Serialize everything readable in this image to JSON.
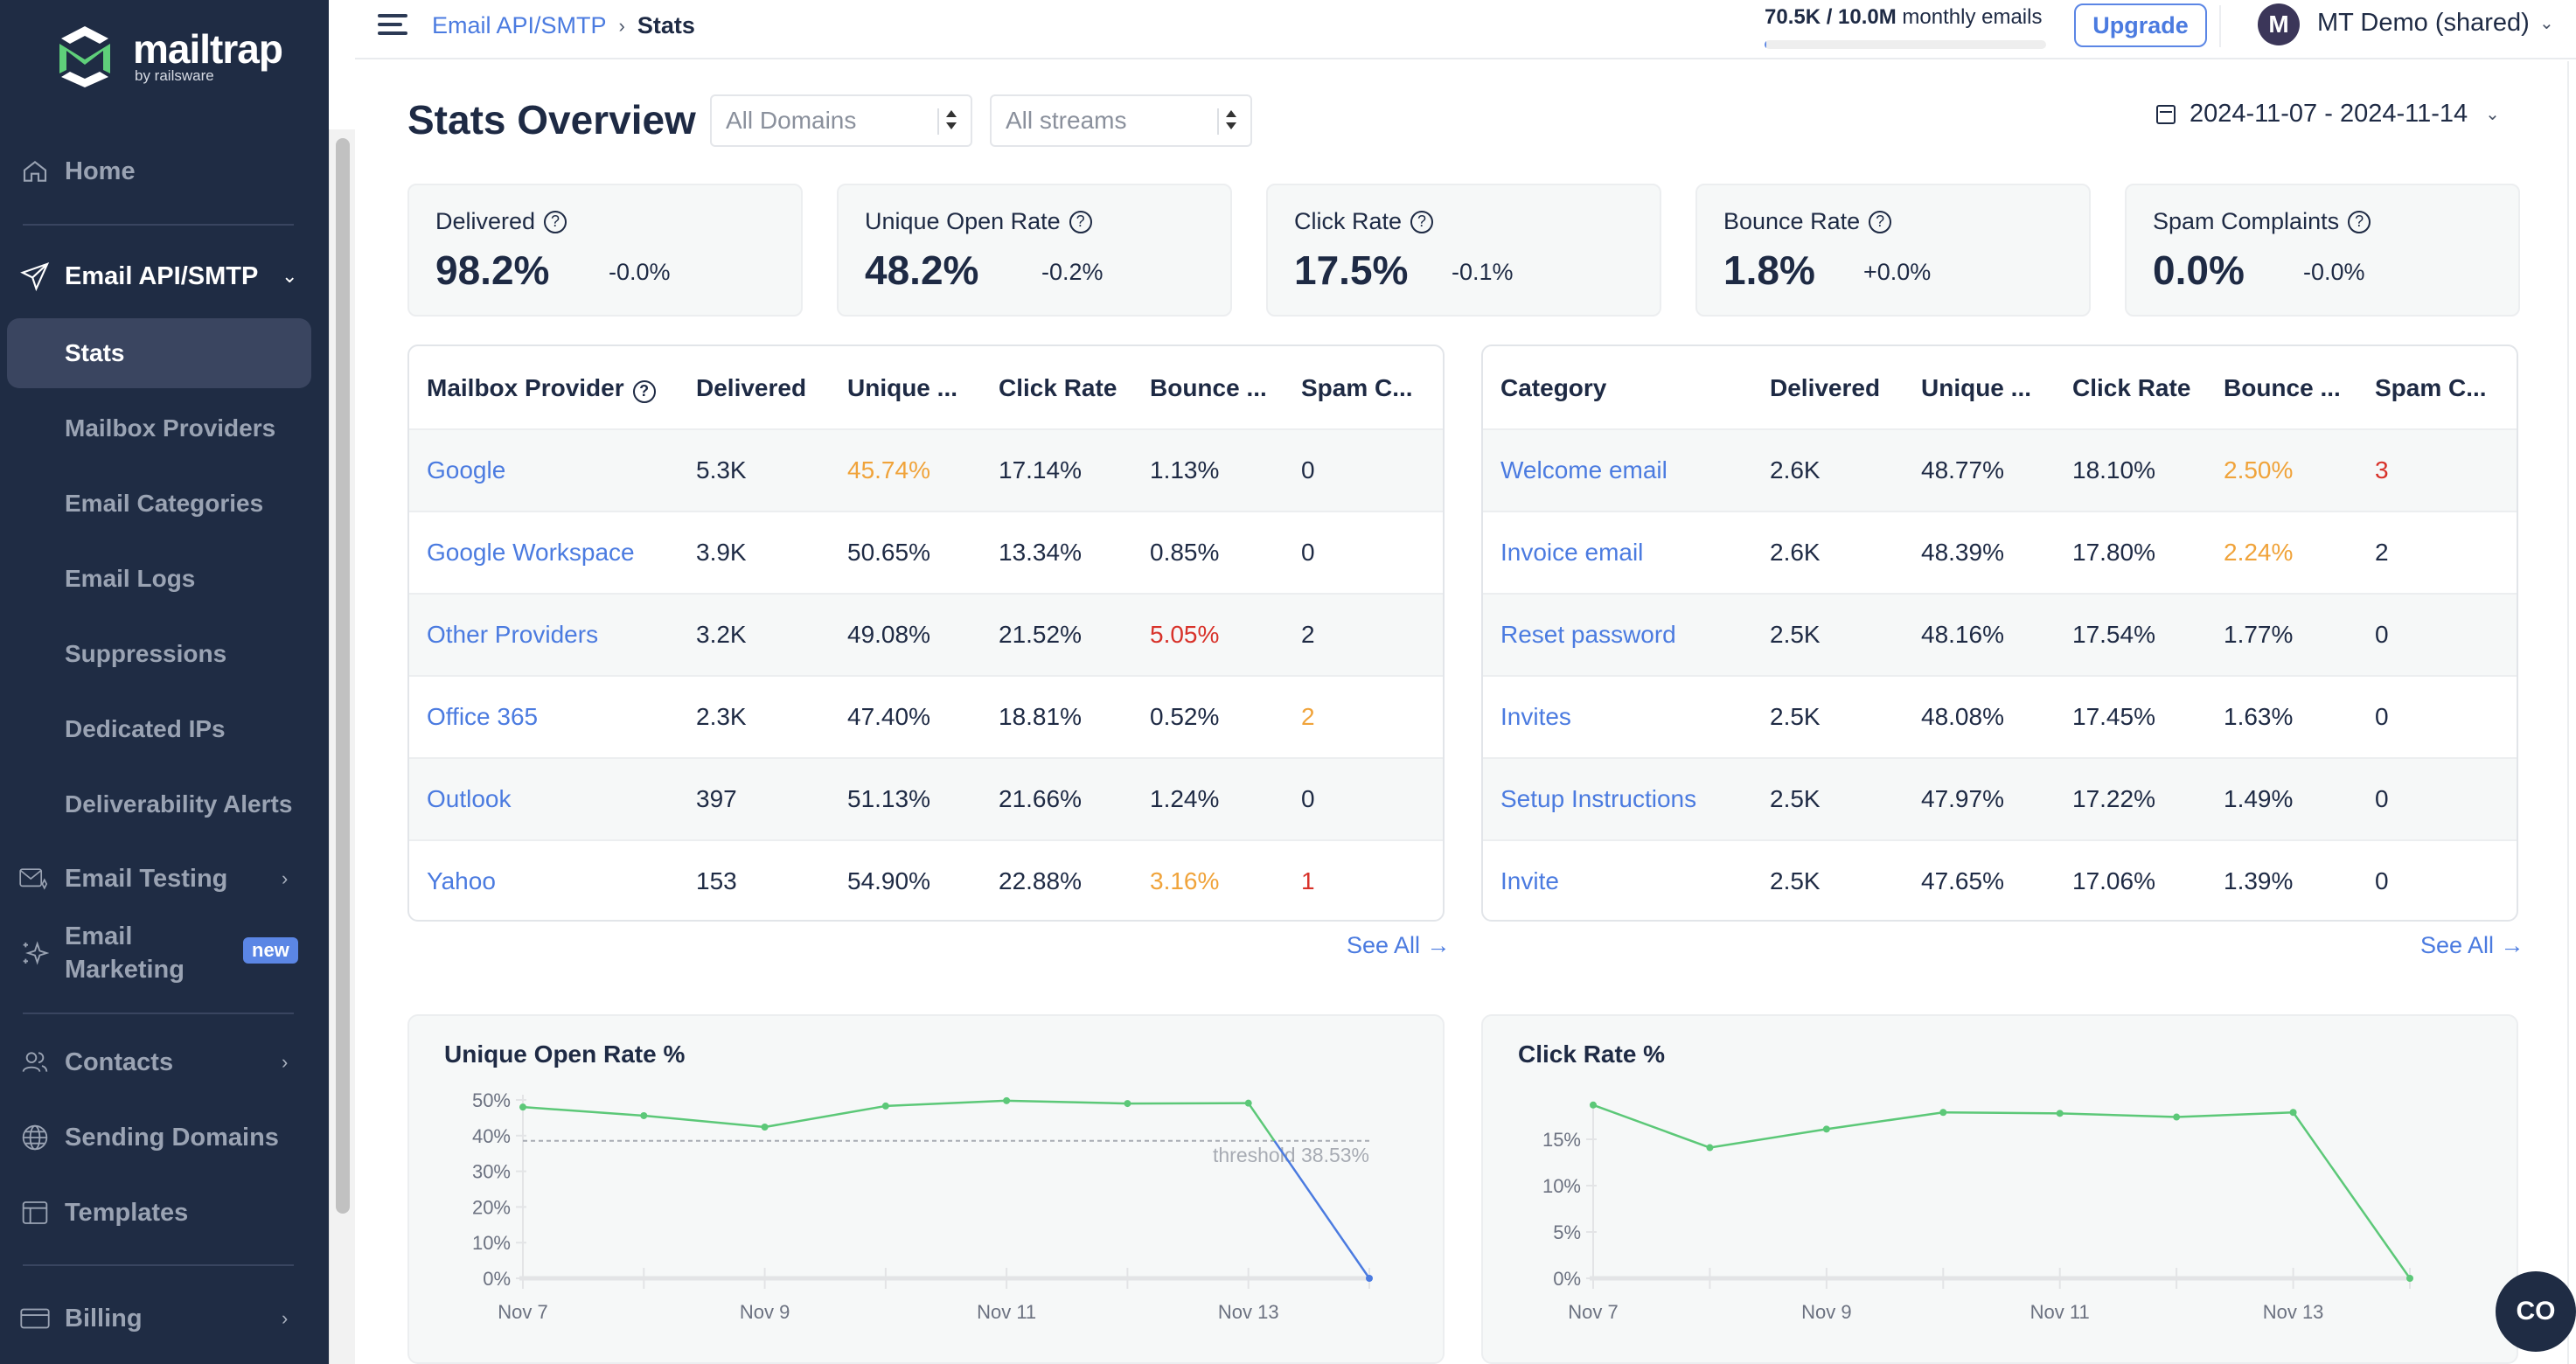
{
  "brand": {
    "name": "mailtrap",
    "sub": "by railsware"
  },
  "sidebar": {
    "home": "Home",
    "section": "Email API/SMTP",
    "sub_items": [
      {
        "label": "Stats",
        "active": true
      },
      {
        "label": "Mailbox Providers"
      },
      {
        "label": "Email Categories"
      },
      {
        "label": "Email Logs"
      },
      {
        "label": "Suppressions"
      },
      {
        "label": "Dedicated IPs"
      },
      {
        "label": "Deliverability Alerts"
      }
    ],
    "email_testing": "Email Testing",
    "email_marketing": "Email Marketing",
    "email_marketing_line1": "Email",
    "email_marketing_line2": "Marketing",
    "new_badge": "new",
    "contacts": "Contacts",
    "sending_domains": "Sending Domains",
    "templates": "Templates",
    "billing": "Billing"
  },
  "header": {
    "breadcrumb_parent": "Email API/SMTP",
    "breadcrumb_sep": "›",
    "breadcrumb_current": "Stats",
    "usage_bold": "70.5K / 10.0M",
    "usage_text": " monthly emails",
    "usage_fraction": 0.00705,
    "upgrade": "Upgrade",
    "avatar_initial": "M",
    "account": "MT Demo (shared)",
    "chevron": "⌄"
  },
  "page": {
    "title": "Stats Overview",
    "domain_select": "All Domains",
    "stream_select": "All streams",
    "date_range": "2024-11-07 - 2024-11-14"
  },
  "metrics": [
    {
      "title": "Delivered",
      "value": "98.2%",
      "delta": "-0.0%"
    },
    {
      "title": "Unique Open Rate",
      "value": "48.2%",
      "delta": "-0.2%"
    },
    {
      "title": "Click Rate",
      "value": "17.5%",
      "delta": "-0.1%"
    },
    {
      "title": "Bounce Rate",
      "value": "1.8%",
      "delta": "+0.0%"
    },
    {
      "title": "Spam Complaints",
      "value": "0.0%",
      "delta": "-0.0%"
    }
  ],
  "colors": {
    "warn": "#f0a33a",
    "danger": "#d8322a",
    "normal": "#1e2a44",
    "link": "#4b7be0",
    "line_green": "#5cc878",
    "line_blue": "#4b7be0"
  },
  "providers_table": {
    "headers": [
      "Mailbox Provider",
      "Delivered",
      "Unique ...",
      "Click Rate",
      "Bounce ...",
      "Spam C..."
    ],
    "rows": [
      {
        "name": "Google",
        "cells": [
          "5.3K",
          "45.74%",
          "17.14%",
          "1.13%",
          "0"
        ],
        "status": [
          "normal",
          "warn",
          "normal",
          "normal",
          "normal"
        ]
      },
      {
        "name": "Google Workspace",
        "cells": [
          "3.9K",
          "50.65%",
          "13.34%",
          "0.85%",
          "0"
        ],
        "status": [
          "normal",
          "normal",
          "normal",
          "normal",
          "normal"
        ]
      },
      {
        "name": "Other Providers",
        "cells": [
          "3.2K",
          "49.08%",
          "21.52%",
          "5.05%",
          "2"
        ],
        "status": [
          "normal",
          "normal",
          "normal",
          "danger",
          "normal"
        ]
      },
      {
        "name": "Office 365",
        "cells": [
          "2.3K",
          "47.40%",
          "18.81%",
          "0.52%",
          "2"
        ],
        "status": [
          "normal",
          "normal",
          "normal",
          "normal",
          "warn"
        ]
      },
      {
        "name": "Outlook",
        "cells": [
          "397",
          "51.13%",
          "21.66%",
          "1.24%",
          "0"
        ],
        "status": [
          "normal",
          "normal",
          "normal",
          "normal",
          "normal"
        ]
      },
      {
        "name": "Yahoo",
        "cells": [
          "153",
          "54.90%",
          "22.88%",
          "3.16%",
          "1"
        ],
        "status": [
          "normal",
          "normal",
          "normal",
          "warn",
          "danger"
        ]
      }
    ],
    "see_all": "See All →"
  },
  "categories_table": {
    "headers": [
      "Category",
      "Delivered",
      "Unique ...",
      "Click Rate",
      "Bounce ...",
      "Spam C..."
    ],
    "rows": [
      {
        "name": "Welcome email",
        "cells": [
          "2.6K",
          "48.77%",
          "18.10%",
          "2.50%",
          "3"
        ],
        "status": [
          "normal",
          "normal",
          "normal",
          "warn",
          "danger"
        ]
      },
      {
        "name": "Invoice email",
        "cells": [
          "2.6K",
          "48.39%",
          "17.80%",
          "2.24%",
          "2"
        ],
        "status": [
          "normal",
          "normal",
          "normal",
          "warn",
          "normal"
        ]
      },
      {
        "name": "Reset password",
        "cells": [
          "2.5K",
          "48.16%",
          "17.54%",
          "1.77%",
          "0"
        ],
        "status": [
          "normal",
          "normal",
          "normal",
          "normal",
          "normal"
        ]
      },
      {
        "name": "Invites",
        "cells": [
          "2.5K",
          "48.08%",
          "17.45%",
          "1.63%",
          "0"
        ],
        "status": [
          "normal",
          "normal",
          "normal",
          "normal",
          "normal"
        ]
      },
      {
        "name": "Setup Instructions",
        "cells": [
          "2.5K",
          "47.97%",
          "17.22%",
          "1.49%",
          "0"
        ],
        "status": [
          "normal",
          "normal",
          "normal",
          "normal",
          "normal"
        ]
      },
      {
        "name": "Invite",
        "cells": [
          "2.5K",
          "47.65%",
          "17.06%",
          "1.39%",
          "0"
        ],
        "status": [
          "normal",
          "normal",
          "normal",
          "normal",
          "normal"
        ]
      }
    ],
    "see_all": "See All →"
  },
  "chart_data": [
    {
      "type": "line",
      "title": "Unique Open Rate %",
      "x": [
        "Nov 7",
        "Nov 8",
        "Nov 9",
        "Nov 10",
        "Nov 11",
        "Nov 12",
        "Nov 13",
        "Nov 14"
      ],
      "x_tick_labels": [
        "Nov 7",
        "Nov 9",
        "Nov 11",
        "Nov 13"
      ],
      "series": [
        {
          "name": "Unique Open Rate",
          "values": [
            48.0,
            45.6,
            42.4,
            48.3,
            49.8,
            49.0,
            49.1,
            0
          ]
        }
      ],
      "y_ticks": [
        "0%",
        "10%",
        "20%",
        "30%",
        "40%",
        "50%"
      ],
      "ylim": [
        0,
        50
      ],
      "threshold": {
        "value": 38.53,
        "label": "threshold 38.53%"
      },
      "xlabel": "",
      "ylabel": "",
      "grid": false,
      "legend": "none"
    },
    {
      "type": "line",
      "title": "Click Rate %",
      "x": [
        "Nov 7",
        "Nov 8",
        "Nov 9",
        "Nov 10",
        "Nov 11",
        "Nov 12",
        "Nov 13",
        "Nov 14"
      ],
      "x_tick_labels": [
        "Nov 7",
        "Nov 9",
        "Nov 11",
        "Nov 13"
      ],
      "series": [
        {
          "name": "Click Rate",
          "values": [
            18.7,
            14.1,
            16.1,
            17.9,
            17.8,
            17.4,
            17.9,
            0
          ]
        }
      ],
      "y_ticks": [
        "0%",
        "5%",
        "10%",
        "15%"
      ],
      "ylim": [
        0,
        15
      ],
      "xlabel": "",
      "ylabel": "",
      "grid": false,
      "legend": "none"
    }
  ],
  "chat_widget": {
    "label": "CO"
  }
}
